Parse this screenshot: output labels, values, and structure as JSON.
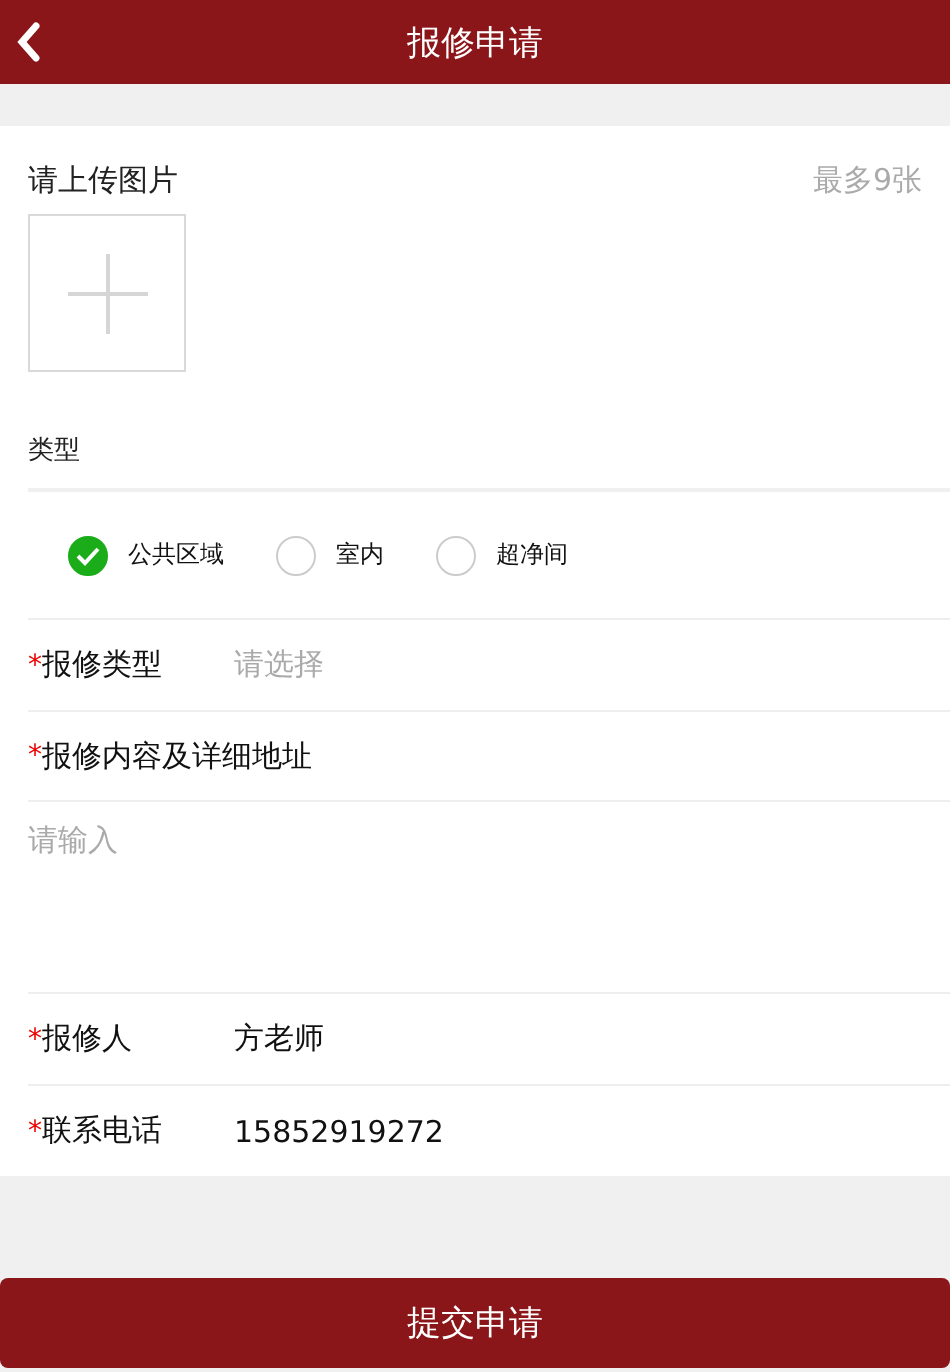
{
  "header": {
    "title": "报修申请"
  },
  "upload": {
    "label": "请上传图片",
    "hint": "最多9张"
  },
  "type_section": {
    "label": "类型",
    "options": [
      {
        "label": "公共区域",
        "selected": true
      },
      {
        "label": "室内",
        "selected": false
      },
      {
        "label": "超净间",
        "selected": false
      }
    ]
  },
  "fields": [
    {
      "kind": "select",
      "mark": "*",
      "label": "报修类型",
      "placeholder": "请选择"
    },
    {
      "kind": "textarea",
      "mark": "*",
      "label": "报修内容及详细地址",
      "placeholder": "请输入"
    },
    {
      "kind": "text",
      "mark": "*",
      "label": "报修人",
      "value": "方老师"
    },
    {
      "kind": "text",
      "mark": "*",
      "label": "联系电话",
      "value": "15852919272"
    }
  ],
  "submit_button": "提交申请"
}
